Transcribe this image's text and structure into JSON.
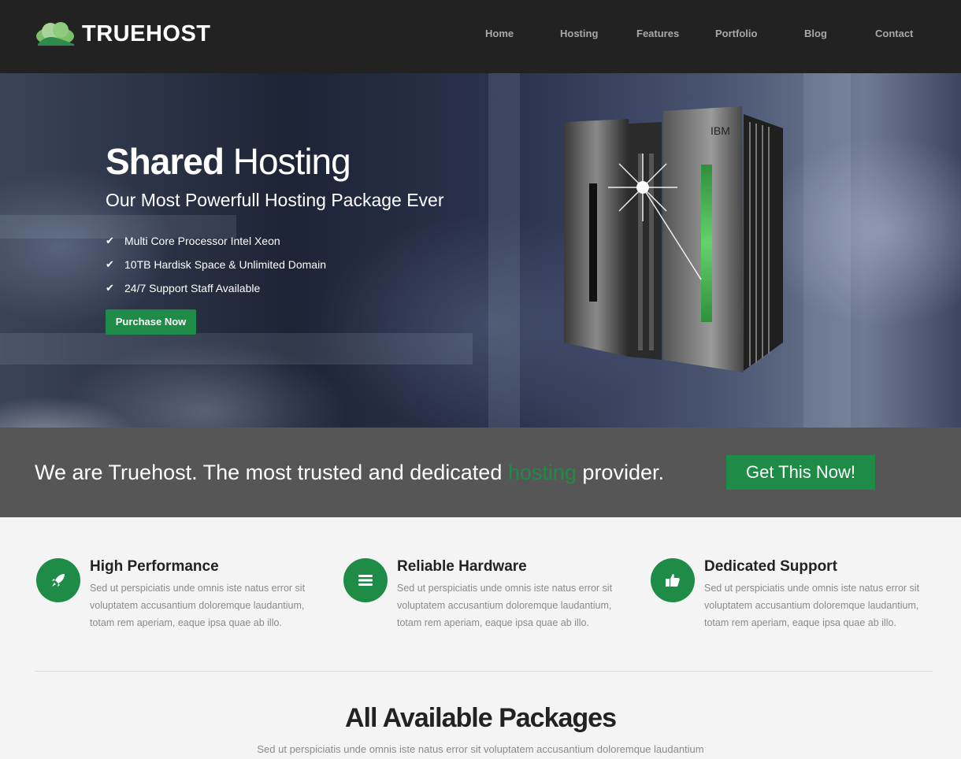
{
  "brand": {
    "name": "TRUEHOST"
  },
  "nav": {
    "items": [
      {
        "label": "Home"
      },
      {
        "label": "Hosting"
      },
      {
        "label": "Features"
      },
      {
        "label": "Portfolio"
      },
      {
        "label": "Blog"
      },
      {
        "label": "Contact"
      }
    ]
  },
  "hero": {
    "title_bold": "Shared",
    "title_light": "Hosting",
    "subtitle": "Our Most Powerfull Hosting Package Ever",
    "bullets": [
      "Multi Core Processor Intel Xeon",
      "10TB Hardisk Space & Unlimited Domain",
      "24/7 Support Staff Available"
    ],
    "cta_label": "Purchase Now",
    "server_brand": "IBM"
  },
  "cta": {
    "text_before": "We are Truehost. The most trusted and dedicated ",
    "text_accent": "hosting",
    "text_after": " provider.",
    "button_label": "Get This Now!"
  },
  "features": [
    {
      "icon": "rocket-icon",
      "title": "High Performance",
      "desc": "Sed ut perspiciatis unde omnis iste natus error sit voluptatem accusantium doloremque laudantium, totam rem aperiam, eaque ipsa quae ab illo."
    },
    {
      "icon": "list-icon",
      "title": "Reliable Hardware",
      "desc": "Sed ut perspiciatis unde omnis iste natus error sit voluptatem accusantium doloremque laudantium, totam rem aperiam, eaque ipsa quae ab illo."
    },
    {
      "icon": "thumbs-up-icon",
      "title": "Dedicated Support",
      "desc": "Sed ut perspiciatis unde omnis iste natus error sit voluptatem accusantium doloremque laudantium, totam rem aperiam, eaque ipsa quae ab illo."
    }
  ],
  "packages": {
    "title": "All Available Packages",
    "subtitle": "Sed ut perspiciatis unde omnis iste natus error sit voluptatem accusantium doloremque laudantium"
  },
  "colors": {
    "accent": "#1e8b47",
    "header_bg": "#222222",
    "band_bg": "#565656",
    "page_bg": "#f4f4f4"
  }
}
